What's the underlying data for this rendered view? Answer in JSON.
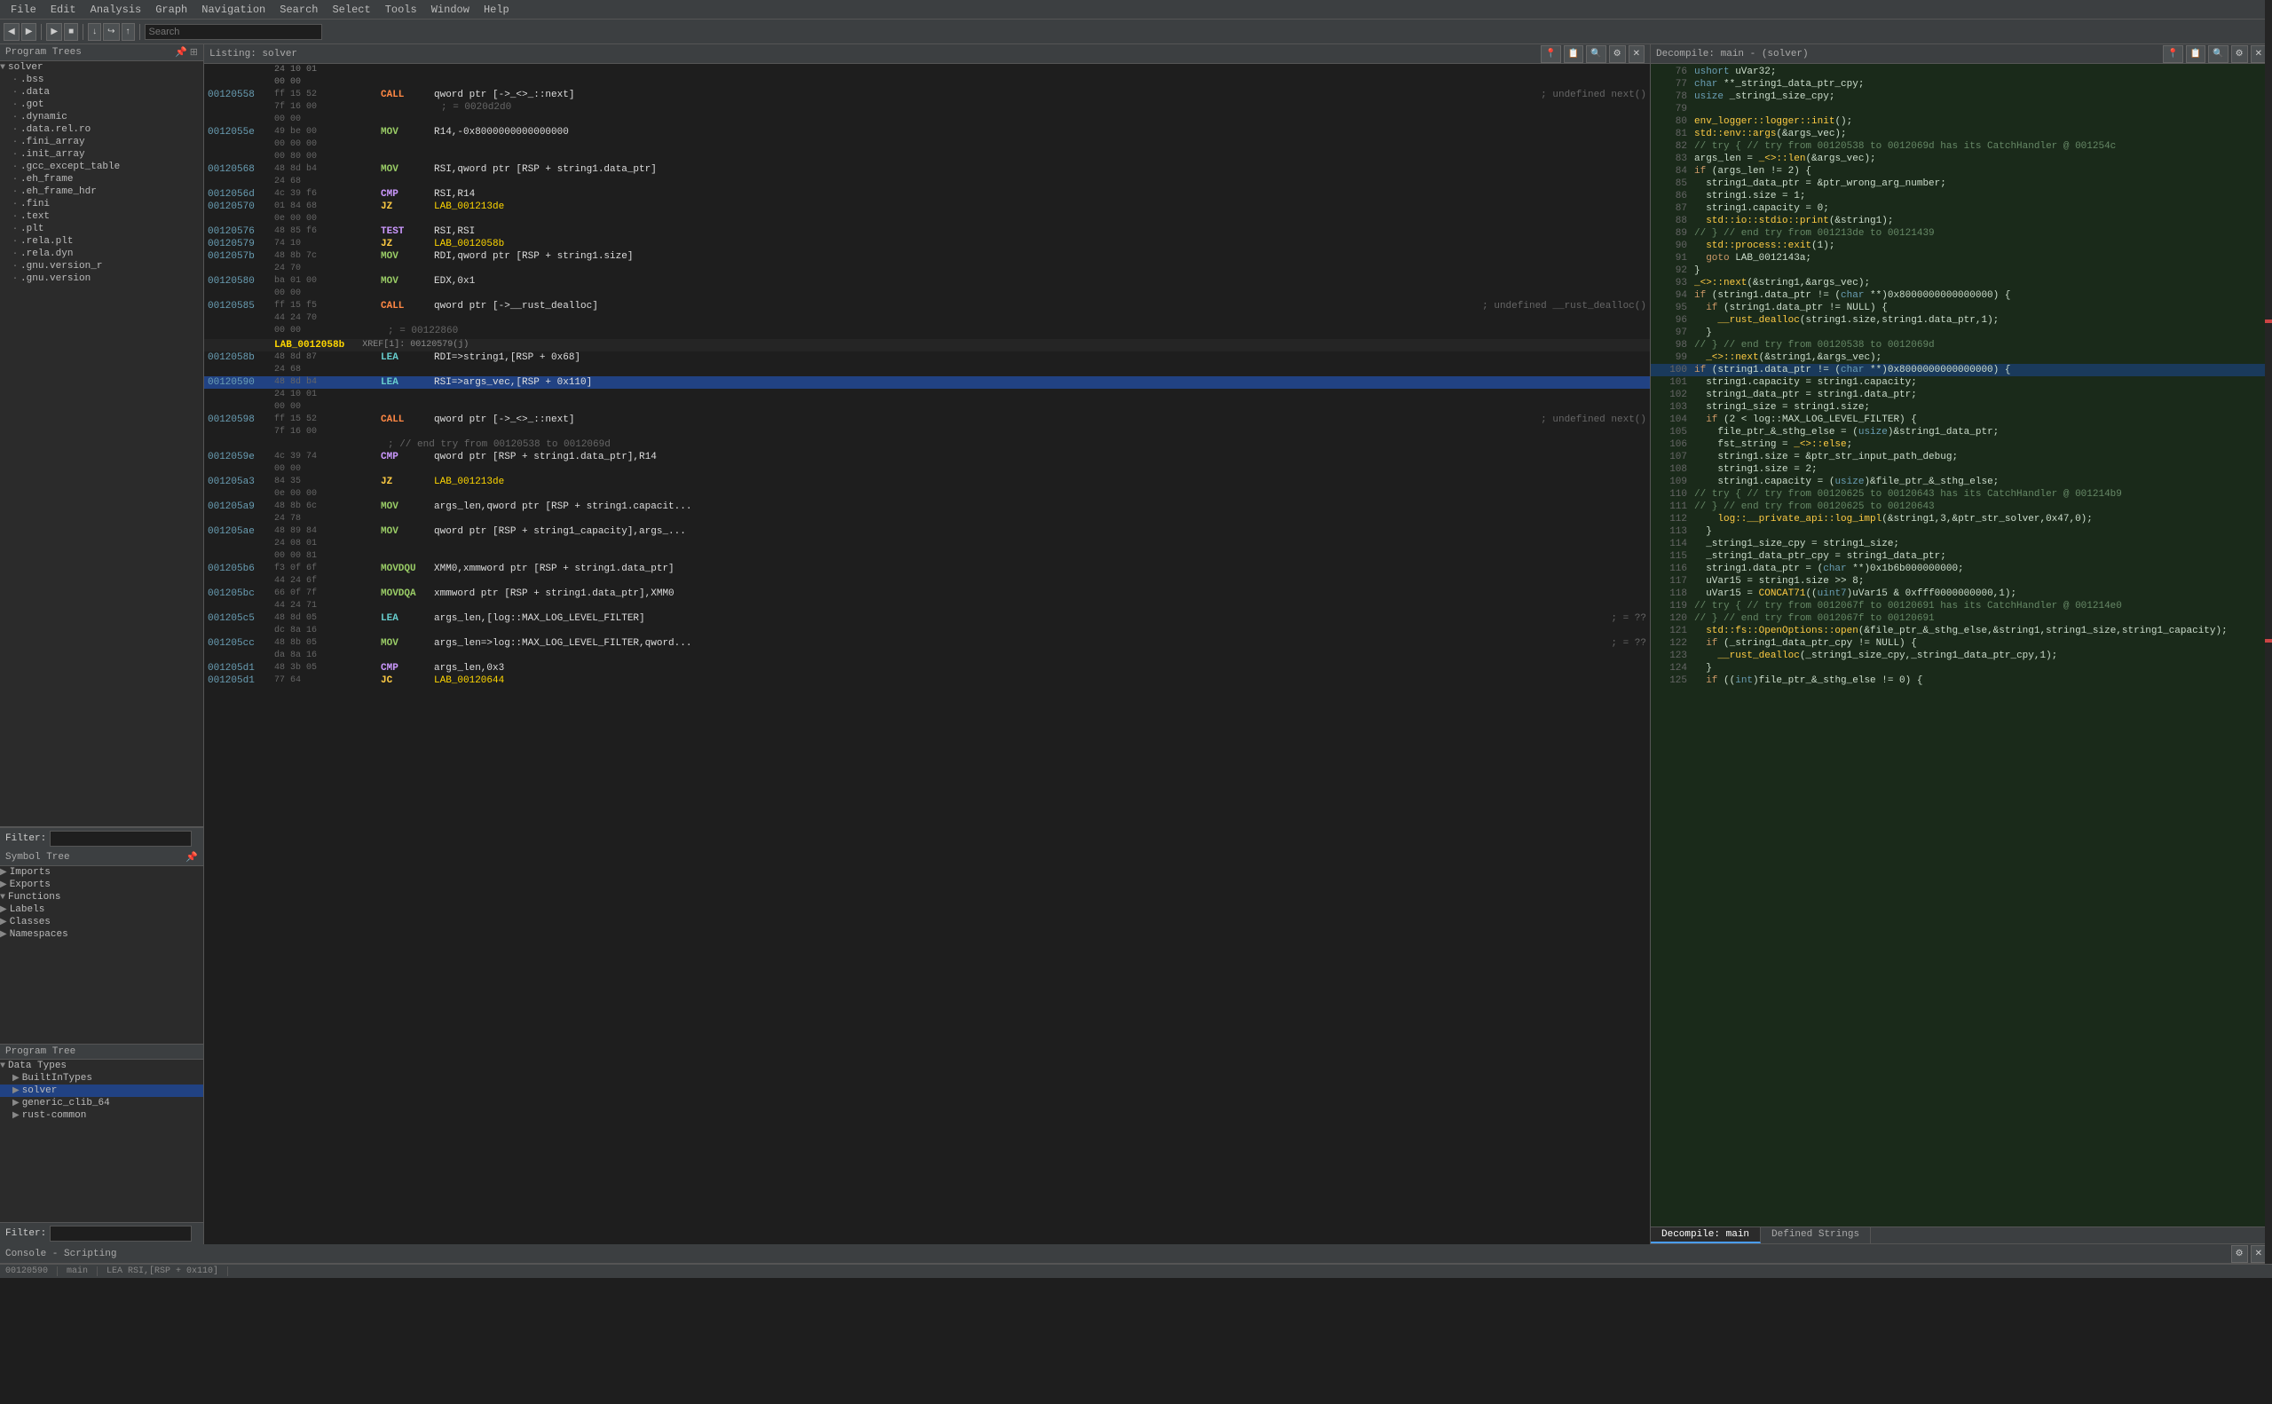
{
  "menubar": {
    "items": [
      "File",
      "Edit",
      "Analysis",
      "Graph",
      "Navigation",
      "Search",
      "Select",
      "Tools",
      "Window",
      "Help"
    ]
  },
  "header": {
    "search_placeholder": "Search"
  },
  "program_trees": {
    "title": "Program Trees",
    "items": [
      {
        "label": "solver",
        "indent": 0,
        "icon": "▼"
      },
      {
        "label": ".bss",
        "indent": 1,
        "icon": "·"
      },
      {
        "label": ".data",
        "indent": 1,
        "icon": "·"
      },
      {
        "label": ".got",
        "indent": 1,
        "icon": "·"
      },
      {
        "label": ".dynamic",
        "indent": 1,
        "icon": "·"
      },
      {
        "label": ".data.rel.ro",
        "indent": 1,
        "icon": "·"
      },
      {
        "label": ".fini_array",
        "indent": 1,
        "icon": "·"
      },
      {
        "label": ".init_array",
        "indent": 1,
        "icon": "·"
      },
      {
        "label": ".gcc_except_table",
        "indent": 1,
        "icon": "·"
      },
      {
        "label": ".eh_frame",
        "indent": 1,
        "icon": "·"
      },
      {
        "label": ".eh_frame_hdr",
        "indent": 1,
        "icon": "·"
      },
      {
        "label": ".fini",
        "indent": 1,
        "icon": "·"
      },
      {
        "label": ".text",
        "indent": 1,
        "icon": "·"
      },
      {
        "label": ".plt",
        "indent": 1,
        "icon": "·"
      },
      {
        "label": ".rela.plt",
        "indent": 1,
        "icon": "·"
      },
      {
        "label": ".rela.dyn",
        "indent": 1,
        "icon": "·"
      },
      {
        "label": ".gnu.version_r",
        "indent": 1,
        "icon": "·"
      },
      {
        "label": ".gnu.version",
        "indent": 1,
        "icon": "·"
      },
      {
        "label": "...",
        "indent": 1,
        "icon": "·"
      }
    ],
    "filter_label": "Filter:"
  },
  "symbol_tree": {
    "title": "Symbol Tree",
    "items": [
      {
        "label": "Imports",
        "indent": 0,
        "icon": "▶"
      },
      {
        "label": "Exports",
        "indent": 0,
        "icon": "▶"
      },
      {
        "label": "Functions",
        "indent": 0,
        "icon": "▼"
      },
      {
        "label": "Labels",
        "indent": 0,
        "icon": "▶"
      },
      {
        "label": "Classes",
        "indent": 0,
        "icon": "▶"
      },
      {
        "label": "Namespaces",
        "indent": 0,
        "icon": "▶"
      }
    ]
  },
  "program_tree_bottom": {
    "title": "Program Tree",
    "items": [
      {
        "label": "Data Types",
        "indent": 0,
        "icon": "▼"
      },
      {
        "label": "BuiltInTypes",
        "indent": 1,
        "icon": "▶"
      },
      {
        "label": "solver",
        "indent": 1,
        "icon": "▶"
      },
      {
        "label": "generic_clib_64",
        "indent": 1,
        "icon": "▶"
      },
      {
        "label": "rust-common",
        "indent": 1,
        "icon": "▶"
      }
    ]
  },
  "listing": {
    "title": "Listing: solver",
    "lines": [
      {
        "addr": "00120558",
        "bytes": "ff 15 52",
        "mnem": "CALL",
        "operands": "qword ptr [->_<>_::next]",
        "comment": "; undefined next()",
        "type": "call"
      },
      {
        "addr": "",
        "bytes": "7f 16 00",
        "mnem": "",
        "operands": "",
        "comment": "; = 0020d2d0"
      },
      {
        "addr": "",
        "bytes": "00 00",
        "mnem": "",
        "operands": "",
        "comment": ""
      },
      {
        "addr": "0012055e",
        "bytes": "49 be 00",
        "mnem": "MOV",
        "operands": "R14,-0x8000000000000000",
        "comment": "",
        "type": "mov"
      },
      {
        "addr": "",
        "bytes": "00 00 00",
        "mnem": "",
        "operands": "",
        "comment": ""
      },
      {
        "addr": "",
        "bytes": "00 80 00",
        "mnem": "",
        "operands": "",
        "comment": ""
      },
      {
        "addr": "00120568",
        "bytes": "48 8d b4",
        "mnem": "MOV",
        "operands": "RSI,qword ptr [RSP + string1.data_ptr]",
        "comment": "",
        "type": "mov"
      },
      {
        "addr": "",
        "bytes": "24 68",
        "mnem": "",
        "operands": "",
        "comment": ""
      },
      {
        "addr": "0012056d",
        "bytes": "4c 39 f6",
        "mnem": "CMP",
        "operands": "RSI,R14",
        "comment": "",
        "type": "cmp"
      },
      {
        "addr": "00120570",
        "bytes": "01 84 68",
        "mnem": "JZ",
        "operands": "LAB_001213de",
        "comment": "",
        "type": "jz"
      },
      {
        "addr": "",
        "bytes": "0e 00 00",
        "mnem": "",
        "operands": "",
        "comment": ""
      },
      {
        "addr": "00120576",
        "bytes": "48 85 f6",
        "mnem": "TEST",
        "operands": "RSI,RSI",
        "comment": "",
        "type": "test"
      },
      {
        "addr": "00120579",
        "bytes": "74 10",
        "mnem": "JZ",
        "operands": "LAB_0012058b",
        "comment": "",
        "type": "jz"
      },
      {
        "addr": "0012057b",
        "bytes": "48 8b 7c",
        "mnem": "MOV",
        "operands": "RDI,qword ptr [RSP + string1.size]",
        "comment": "",
        "type": "mov"
      },
      {
        "addr": "",
        "bytes": "24 70",
        "mnem": "",
        "operands": "",
        "comment": ""
      },
      {
        "addr": "00120580",
        "bytes": "ba 01 00",
        "mnem": "MOV",
        "operands": "EDX,0x1",
        "comment": "",
        "type": "mov"
      },
      {
        "addr": "",
        "bytes": "00 00",
        "mnem": "",
        "operands": "",
        "comment": ""
      },
      {
        "addr": "00120585",
        "bytes": "ff 15 f5",
        "mnem": "CALL",
        "operands": "qword ptr [->__rust_dealloc]",
        "comment": "; undefined __rust_dealloc()",
        "type": "call"
      },
      {
        "addr": "",
        "bytes": "44 24 70",
        "mnem": "",
        "operands": "",
        "comment": ""
      },
      {
        "addr": "",
        "bytes": "00 00",
        "mnem": "",
        "operands": "",
        "comment": "; = 00122860"
      },
      {
        "addr": "LAB_0012058b",
        "bytes": "",
        "mnem": "",
        "operands": "",
        "comment": "XREF[1]:  00120579(j)",
        "type": "label"
      },
      {
        "addr": "0012058b",
        "bytes": "48 8d 87",
        "mnem": "LEA",
        "operands": "RDI=>string1,[RSP + 0x68]",
        "comment": "",
        "type": "lea"
      },
      {
        "addr": "",
        "bytes": "24 68",
        "mnem": "",
        "operands": "",
        "comment": ""
      },
      {
        "addr": "00120590",
        "bytes": "48 8d b4",
        "mnem": "LEA",
        "operands": "RSI=>args_vec,[RSP + 0x110]",
        "comment": "",
        "type": "lea",
        "selected": true
      },
      {
        "addr": "",
        "bytes": "24 10 01",
        "mnem": "",
        "operands": "",
        "comment": ""
      },
      {
        "addr": "",
        "bytes": "00 00",
        "mnem": "",
        "operands": "",
        "comment": ""
      },
      {
        "addr": "00120598",
        "bytes": "ff 15 52",
        "mnem": "CALL",
        "operands": "qword ptr [->_<>_::next]",
        "comment": "; undefined next()",
        "type": "call"
      },
      {
        "addr": "",
        "bytes": "7f 16 00",
        "mnem": "",
        "operands": "",
        "comment": ""
      },
      {
        "addr": "",
        "bytes": "",
        "mnem": "",
        "operands": "",
        "comment": "; // end try from 00120538 to 0012069d"
      },
      {
        "addr": "0012059e",
        "bytes": "4c 39 74",
        "mnem": "CMP",
        "operands": "qword ptr [RSP + string1.data_ptr],R14",
        "comment": "",
        "type": "cmp"
      },
      {
        "addr": "",
        "bytes": "00 00",
        "mnem": "",
        "operands": "",
        "comment": ""
      },
      {
        "addr": "001205a3",
        "bytes": "84 35",
        "mnem": "JZ",
        "operands": "LAB_001213de",
        "comment": "",
        "type": "jz"
      },
      {
        "addr": "",
        "bytes": "0e 00 00",
        "mnem": "",
        "operands": "",
        "comment": ""
      },
      {
        "addr": "001205a9",
        "bytes": "48 8b 6c",
        "mnem": "MOV",
        "operands": "args_len,qword ptr [RSP + string1.capacit...",
        "comment": "",
        "type": "mov"
      },
      {
        "addr": "",
        "bytes": "24 78",
        "mnem": "",
        "operands": "",
        "comment": ""
      },
      {
        "addr": "001205ae",
        "bytes": "48 89 84",
        "mnem": "MOV",
        "operands": "qword ptr [RSP + string1_capacity],args_...",
        "comment": "",
        "type": "mov"
      },
      {
        "addr": "",
        "bytes": "24 08 01",
        "mnem": "",
        "operands": "",
        "comment": ""
      },
      {
        "addr": "",
        "bytes": "00 00 81",
        "mnem": "",
        "operands": "",
        "comment": ""
      },
      {
        "addr": "001205b6",
        "bytes": "f3 0f 6f",
        "mnem": "MOVDQU",
        "operands": "XMM0,xmmword ptr [RSP + string1.data_ptr]",
        "comment": "",
        "type": "movdqu"
      },
      {
        "addr": "",
        "bytes": "44 24 6f",
        "mnem": "",
        "operands": "",
        "comment": ""
      },
      {
        "addr": "001205bc",
        "bytes": "66 0f 7f",
        "mnem": "MOVDQA",
        "operands": "xmmword ptr [RSP + string1.data_ptr],XMM0",
        "comment": "",
        "type": "movdqa"
      },
      {
        "addr": "",
        "bytes": "44 24 71",
        "mnem": "",
        "operands": "",
        "comment": ""
      },
      {
        "addr": "001205c5",
        "bytes": "48 8d 05",
        "mnem": "LEA",
        "operands": "args_len,[log::MAX_LOG_LEVEL_FILTER]",
        "comment": "; = ??",
        "type": "lea"
      },
      {
        "addr": "",
        "bytes": "dc 8a 16",
        "mnem": "",
        "operands": "",
        "comment": ""
      },
      {
        "addr": "001205cc",
        "bytes": "48 8b 05",
        "mnem": "MOV",
        "operands": "args_len=>log::MAX_LOG_LEVEL_FILTER,qword...",
        "comment": "; = ??",
        "type": "mov"
      },
      {
        "addr": "",
        "bytes": "da 8a 16",
        "mnem": "",
        "operands": "",
        "comment": ""
      },
      {
        "addr": "001205d1",
        "bytes": "48 3b 05",
        "mnem": "CMP",
        "operands": "args_len,0x3",
        "comment": "",
        "type": "cmp"
      },
      {
        "addr": "001205d1",
        "bytes": "77 64",
        "mnem": "JC",
        "operands": "LAB_00120644",
        "comment": "",
        "type": "jc"
      }
    ]
  },
  "decompile": {
    "title": "Decompile: main - (solver)",
    "lines": [
      {
        "num": 76,
        "code": "ushort uVar32;"
      },
      {
        "num": 77,
        "code": "char **_string1_data_ptr_cpy;"
      },
      {
        "num": 78,
        "code": "usize _string1_size_cpy;"
      },
      {
        "num": 79,
        "code": ""
      },
      {
        "num": 80,
        "code": "env_logger::logger::init();"
      },
      {
        "num": 81,
        "code": "std::env::args(&args_vec);"
      },
      {
        "num": 82,
        "code": "// try { // try from 00120538 to 0012069d has its CatchHandler @ 001254c"
      },
      {
        "num": 83,
        "code": "args_len = _<>::len(&args_vec);"
      },
      {
        "num": 84,
        "code": "if (args_len != 2) {",
        "keyword": true
      },
      {
        "num": 85,
        "code": "  string1_data_ptr = &ptr_wrong_arg_number;"
      },
      {
        "num": 86,
        "code": "  string1.size = 1;"
      },
      {
        "num": 87,
        "code": "  string1.capacity = 0;"
      },
      {
        "num": 88,
        "code": "  std::io::stdio::print(&string1);"
      },
      {
        "num": 89,
        "code": "// } // end try from 001213de to 00121439"
      },
      {
        "num": 90,
        "code": "  std::process::exit(1);"
      },
      {
        "num": 91,
        "code": "  goto LAB_0012143a;"
      },
      {
        "num": 92,
        "code": "}"
      },
      {
        "num": 93,
        "code": "_<>::next(&string1,&args_vec);"
      },
      {
        "num": 94,
        "code": "if (string1.data_ptr != (char **)0x8000000000000000) {",
        "keyword": true
      },
      {
        "num": 95,
        "code": "  if (string1.data_ptr != NULL) {",
        "keyword": true
      },
      {
        "num": 96,
        "code": "    __rust_dealloc(string1.size,string1.data_ptr,1);"
      },
      {
        "num": 97,
        "code": "  }"
      },
      {
        "num": 98,
        "code": "// } // end try from 00120538 to 0012069d"
      },
      {
        "num": 99,
        "code": "  _<>::next(&string1,&args_vec);"
      },
      {
        "num": 100,
        "code": "if (string1.data_ptr != (char **)0x8000000000000000) {",
        "highlighted": true
      },
      {
        "num": 101,
        "code": "  string1.capacity = string1.capacity;"
      },
      {
        "num": 102,
        "code": "  string1_data_ptr = string1.data_ptr;"
      },
      {
        "num": 103,
        "code": "  string1_size = string1.size;"
      },
      {
        "num": 104,
        "code": "  if (2 < log::MAX_LOG_LEVEL_FILTER) {",
        "keyword": true
      },
      {
        "num": 105,
        "code": "    file_ptr_&_sthg_else = (usize)&string1_data_ptr;"
      },
      {
        "num": 106,
        "code": "    fst_string = _<>::else;"
      },
      {
        "num": 107,
        "code": "    string1.size = &ptr_str_input_path_debug;"
      },
      {
        "num": 108,
        "code": "    string1.size = 2;"
      },
      {
        "num": 109,
        "code": "    string1.capacity = (usize)&file_ptr_&_sthg_else;"
      },
      {
        "num": 110,
        "code": "// try { // try from 00120625 to 00120643 has its CatchHandler @ 001214b9"
      },
      {
        "num": 111,
        "code": "// } // end try from 00120625 to 00120643"
      },
      {
        "num": 112,
        "code": "    log::__private_api::log_impl(&string1,3,&ptr_str_solver,0x47,0);"
      },
      {
        "num": 113,
        "code": "  }"
      },
      {
        "num": 114,
        "code": "  _string1_size_cpy = string1_size;"
      },
      {
        "num": 115,
        "code": "  _string1_data_ptr_cpy = string1_data_ptr;"
      },
      {
        "num": 116,
        "code": "  string1.data_ptr = (char **)0x1b6b000000000;"
      },
      {
        "num": 117,
        "code": "  uVar15 = string1.size >> 8;"
      },
      {
        "num": 118,
        "code": "  uVar15 = CONCAT71((uint7)uVar15 & 0xfff0000000000,1);"
      },
      {
        "num": 119,
        "code": "// try { // try from 0012067f to 00120691 has its CatchHandler @ 001214e0"
      },
      {
        "num": 120,
        "code": "// } // end try from 0012067f to 00120691"
      },
      {
        "num": 121,
        "code": "  std::fs::OpenOptions::open(&file_ptr_&_sthg_else,&string1,string1_size,string1_capacity);"
      },
      {
        "num": 122,
        "code": "  if (_string1_data_ptr_cpy != NULL) {",
        "keyword": true
      },
      {
        "num": 123,
        "code": "    __rust_dealloc(_string1_size_cpy,_string1_data_ptr_cpy,1);"
      },
      {
        "num": 124,
        "code": "  }"
      },
      {
        "num": 125,
        "code": "  if ((int)file_ptr_&_sthg_else != 0) {",
        "keyword": true
      }
    ],
    "tabs": [
      "Decompile: main",
      "Defined Strings"
    ]
  },
  "console": {
    "title": "Console - Scripting"
  },
  "status_bar": {
    "address": "00120590",
    "function": "main",
    "instruction": "LEA RSI,[RSP + 0x110]"
  }
}
